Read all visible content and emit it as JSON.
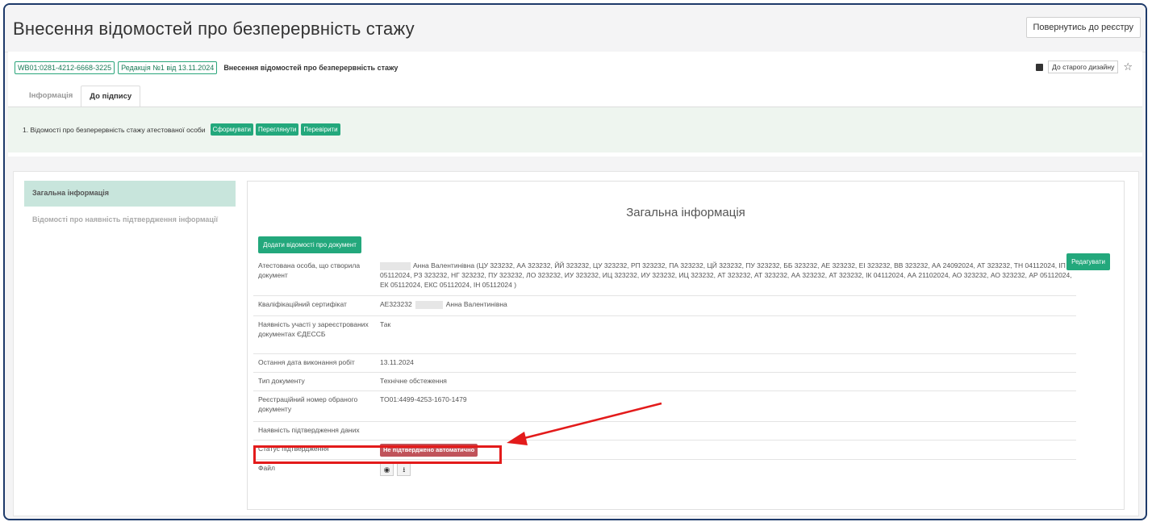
{
  "header": {
    "title": "Внесення відомостей про безперервність стажу",
    "back_button": "Повернутись до реєстру"
  },
  "doc": {
    "id_tag": "WB01:0281-4212-6668-3225",
    "revision_tag": "Редакція №1 від 13.11.2024",
    "title": "Внесення відомостей про безперервність стажу",
    "old_design": "До старого дизайну"
  },
  "tabs": [
    {
      "label": "Інформація"
    },
    {
      "label": "До підпису"
    }
  ],
  "sign_row": {
    "label": "1. Відомості про безперервність стажу атестованої особи",
    "buttons": [
      "Сформувати",
      "Переглянути",
      "Перевірити"
    ]
  },
  "sidebar": {
    "items": [
      {
        "label": "Загальна інформація"
      },
      {
        "label": "Відомості про наявність підтвердження інформації"
      }
    ]
  },
  "content": {
    "title": "Загальна інформація",
    "add_button": "Додати відомості про документ",
    "edit_button": "Редагувати",
    "rows": [
      {
        "label": "Атестована особа, що створила документ",
        "value": "Анна Валентинівна (ЦУ 323232, АА 323232, ЙЙ 323232, ЦУ 323232, РП 323232, ПА 323232, ЦЙ 323232, ПУ 323232, ББ 323232, АЕ 323232, ЕІ 323232, ВВ 323232, АА 24092024, АТ 323232, ТН 04112024, ІП 05112024, РЗ 323232, НГ 323232, ПУ 323232, ЛО 323232, ИУ 323232, ИЦ 323232, ИУ 323232, ИЦ 323232, АТ 323232, АТ 323232, АА 323232, АТ 323232, ІК 04112024, АА 21102024, АО 323232, АО 323232, АР 05112024, ЕК 05112024, ЕКС 05112024, ІН 05112024 )"
      },
      {
        "label": "Кваліфікаційний сертифікат",
        "value_prefix": "АЕ323232",
        "value": "Анна Валентинівна"
      },
      {
        "label": "Наявність участі у зареєстрованих документах ЄДЕССБ",
        "value": "Так"
      },
      {
        "label": "Остання дата виконання робіт",
        "value": "13.11.2024"
      },
      {
        "label": "Тип документу",
        "value": "Технічне обстеження"
      },
      {
        "label": "Реєстраційний номер обраного документу",
        "value": "TO01:4499-4253-1670-1479"
      },
      {
        "label": "Наявність підтвердження даних",
        "value": ""
      },
      {
        "label": "Статус підтвердження",
        "value": "Не підтверджено автоматично"
      },
      {
        "label": "Файл",
        "value": ""
      }
    ]
  },
  "colors": {
    "accent_green": "#23a87c",
    "status_red": "#c0535a",
    "annotation_red": "#e31b1b"
  },
  "icons": [
    "monitor-icon",
    "star-icon",
    "eye-icon",
    "download-icon",
    "arrow-annotation"
  ]
}
